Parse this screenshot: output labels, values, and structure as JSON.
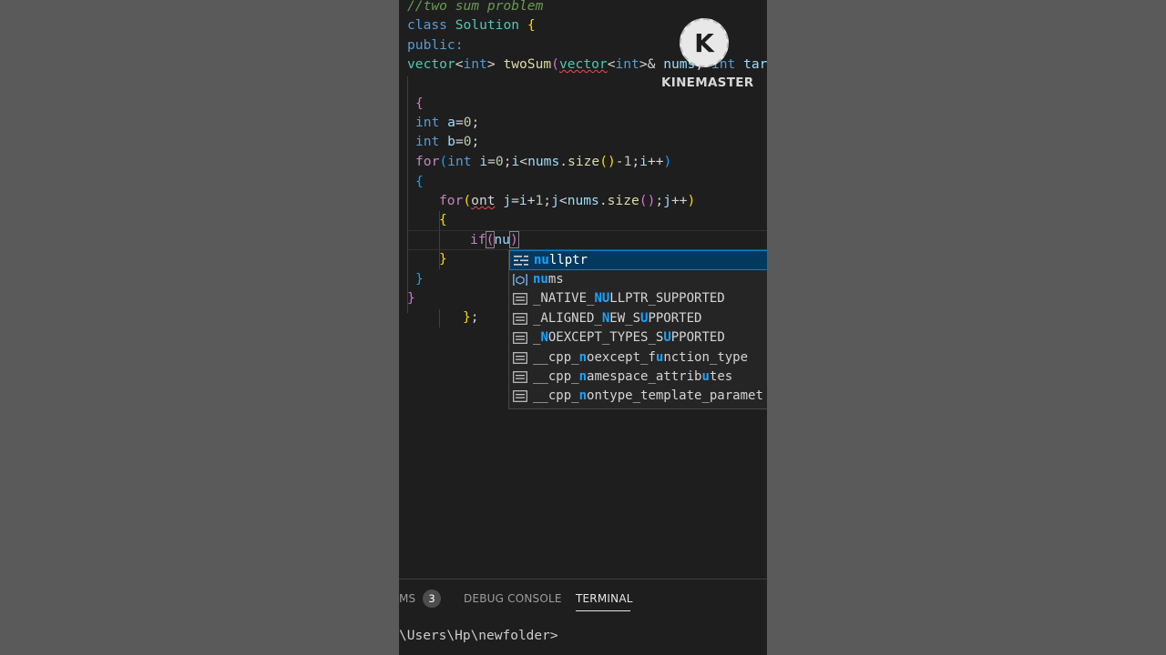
{
  "editor": {
    "comment": "//two sum problem",
    "kw_class": "class",
    "class_name": "Solution",
    "brace_open": "{",
    "brace_close": "}",
    "kw_public": "public:",
    "type_vector": "vector",
    "kw_int": "int",
    "fn_name": "twoSum",
    "param_nums": "nums",
    "param_target": "targe",
    "var_a": "a",
    "var_b": "b",
    "zero": "0",
    "one": "1",
    "kw_for": "for",
    "typo_ont": "ont",
    "var_i": "i",
    "var_j": "j",
    "fn_size": "size",
    "kw_if": "if",
    "typed_text": "nu",
    "semicolon_close": "};"
  },
  "watermark": {
    "logo_letter": "K",
    "brand": "KINEMASTER"
  },
  "suggestions": {
    "items": [
      {
        "icon": "keyword-icon",
        "pre": "",
        "m1": "nu",
        "rest": "llptr",
        "m2": "",
        "tail": ""
      },
      {
        "icon": "variable-icon",
        "pre": "",
        "m1": "nu",
        "rest": "ms",
        "m2": "",
        "tail": ""
      },
      {
        "icon": "text-icon",
        "pre": "_NATIVE_",
        "m1": "NU",
        "rest": "LLPTR_SUPPORTED",
        "m2": "",
        "tail": ""
      },
      {
        "icon": "text-icon",
        "pre": "_ALIGNED_",
        "m1": "N",
        "rest": "EW_S",
        "m2": "U",
        "tail": "PPORTED"
      },
      {
        "icon": "text-icon",
        "pre": "_",
        "m1": "N",
        "rest": "OEXCEPT_TYPES_S",
        "m2": "U",
        "tail": "PPORTED"
      },
      {
        "icon": "text-icon",
        "pre": "__cpp_",
        "m1": "n",
        "rest": "oexcept_f",
        "m2": "u",
        "tail": "nction_type"
      },
      {
        "icon": "text-icon",
        "pre": "__cpp_",
        "m1": "n",
        "rest": "amespace_attrib",
        "m2": "u",
        "tail": "tes"
      },
      {
        "icon": "text-icon",
        "pre": "__cpp_",
        "m1": "n",
        "rest": "ontype_template_paramet",
        "m2": "",
        "tail": ""
      }
    ]
  },
  "panel": {
    "tab_problems_partial": "MS",
    "problems_count": "3",
    "tab_debug": "DEBUG CONSOLE",
    "tab_terminal": "TERMINAL",
    "terminal_line": "\\Users\\Hp\\newfolder>"
  },
  "colors": {
    "editor_bg": "#1e1e1e",
    "selection_bg": "#04395e",
    "match_highlight": "#18a3ff",
    "side_bg": "#5a5a5a"
  }
}
